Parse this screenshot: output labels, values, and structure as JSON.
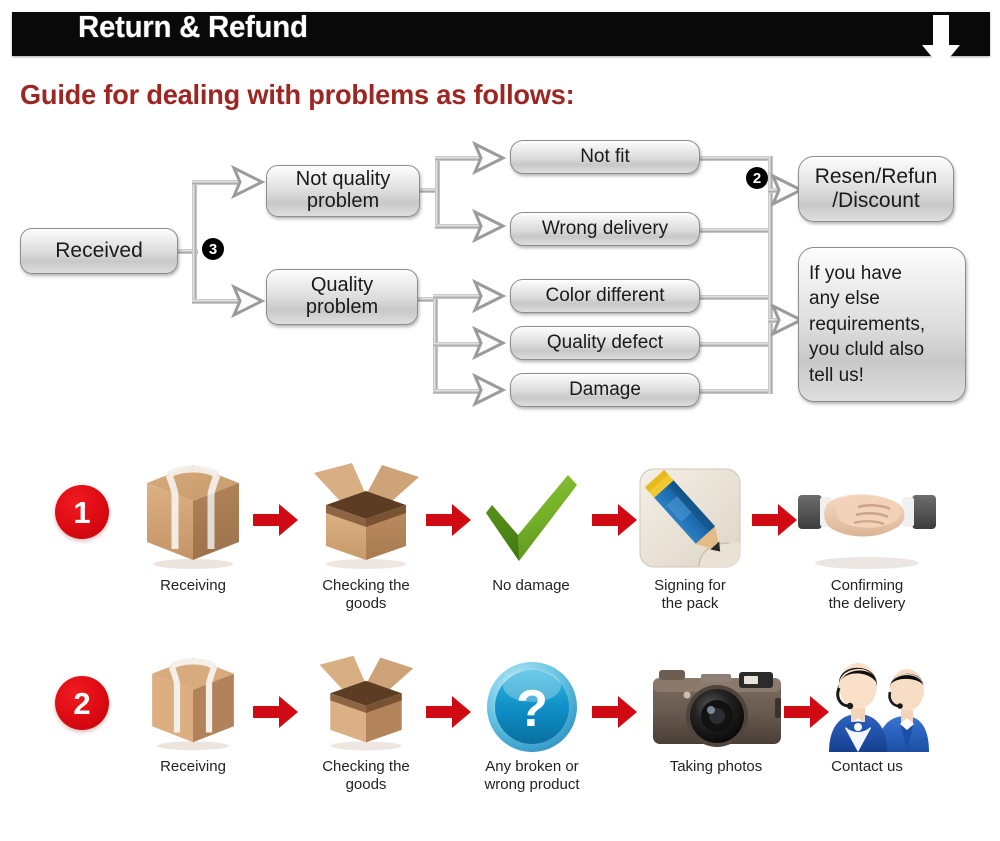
{
  "header": {
    "title": "Return & Refund",
    "down_arrow_icon": "arrow-down-icon",
    "bar_color": "#0a0909",
    "title_color": "#ffffff"
  },
  "guide": {
    "heading": "Guide for dealing with problems as follows:",
    "heading_color": "#9e2622"
  },
  "flowchart": {
    "markers": {
      "three": "3",
      "two": "2"
    },
    "nodes": {
      "received": "Received",
      "not_quality_problem": "Not quality\nproblem",
      "quality_problem": "Quality\nproblem",
      "not_fit": "Not fit",
      "wrong_delivery": "Wrong delivery",
      "color_different": "Color different",
      "quality_defect": "Quality defect",
      "damage": "Damage",
      "resend_refund_discount": "Resen/Refun\n/Discount",
      "else_requirements": "If you have any else requirements, you cluld also tell us!"
    },
    "node_labels_flat": [
      "Received",
      "Not quality problem",
      "Quality problem",
      "Not fit",
      "Wrong delivery",
      "Color different",
      "Quality defect",
      "Damage",
      "Resen/Refun /Discount",
      "If you have any else requirements, you cluld also tell us!"
    ]
  },
  "process": {
    "arrow_color": "#cf0a12",
    "rows": [
      {
        "number": "1",
        "steps": [
          {
            "icon": "sealed-box-icon",
            "label": "Receiving"
          },
          {
            "icon": "open-box-icon",
            "label": "Checking the\ngoods"
          },
          {
            "icon": "green-check-icon",
            "label": "No damage"
          },
          {
            "icon": "pencil-sign-icon",
            "label": "Signing for\nthe pack"
          },
          {
            "icon": "handshake-icon",
            "label": "Confirming\nthe delivery"
          }
        ]
      },
      {
        "number": "2",
        "steps": [
          {
            "icon": "sealed-box-icon",
            "label": "Receiving"
          },
          {
            "icon": "open-box-icon",
            "label": "Checking the\ngoods"
          },
          {
            "icon": "question-mark-icon",
            "label": "Any broken or\nwrong product"
          },
          {
            "icon": "camera-icon",
            "label": "Taking photos"
          },
          {
            "icon": "support-agents-icon",
            "label": "Contact us"
          }
        ]
      }
    ],
    "row1_labels": [
      "Receiving",
      "Checking the goods",
      "No damage",
      "Signing for the pack",
      "Confirming the delivery"
    ],
    "row2_labels": [
      "Receiving",
      "Checking the goods",
      "Any broken or wrong product",
      "Taking photos",
      "Contact us"
    ]
  }
}
